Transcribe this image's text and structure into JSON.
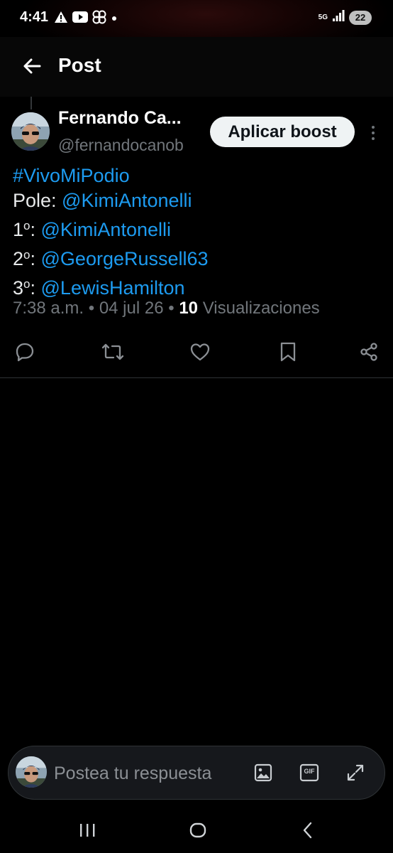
{
  "status_bar": {
    "time": "4:41",
    "network": "5G",
    "battery": "22",
    "left_icons": [
      "warning-icon",
      "youtube-icon",
      "pinwheel-icon",
      "dot-icon"
    ],
    "right_icons": [
      "5g-icon",
      "signal-icon",
      "battery-icon"
    ]
  },
  "header": {
    "title": "Post"
  },
  "post": {
    "author_name": "Fernando Ca...",
    "author_handle": "@fernandocanob",
    "boost_label": "Aplicar boost",
    "hashtag": "#VivoMiPodio",
    "pole_label": "Pole: ",
    "pole_mention": "@KimiAntonelli",
    "first_num": "1",
    "first_ord": "o",
    "first_sep": ": ",
    "first_mention": "@KimiAntonelli",
    "second_num": "2",
    "second_ord": "o",
    "second_sep": ": ",
    "second_mention": "@GeorgeRussell63",
    "third_num": "3",
    "third_ord": "o",
    "third_sep": ": ",
    "third_mention": "@LewisHamilton",
    "time": "7:38 a.m.",
    "date": "04 jul 26",
    "views_count": "10",
    "views_label": "Visualizaciones",
    "bullet": " • "
  },
  "actions": [
    "reply-icon",
    "repost-icon",
    "like-icon",
    "bookmark-icon",
    "share-icon"
  ],
  "reply_bar": {
    "placeholder": "Postea tu respuesta",
    "gif_label": "GIF"
  },
  "colors": {
    "background": "#000000",
    "link": "#1d9bf0",
    "muted": "#71767b",
    "boost_bg": "#eff3f4"
  }
}
